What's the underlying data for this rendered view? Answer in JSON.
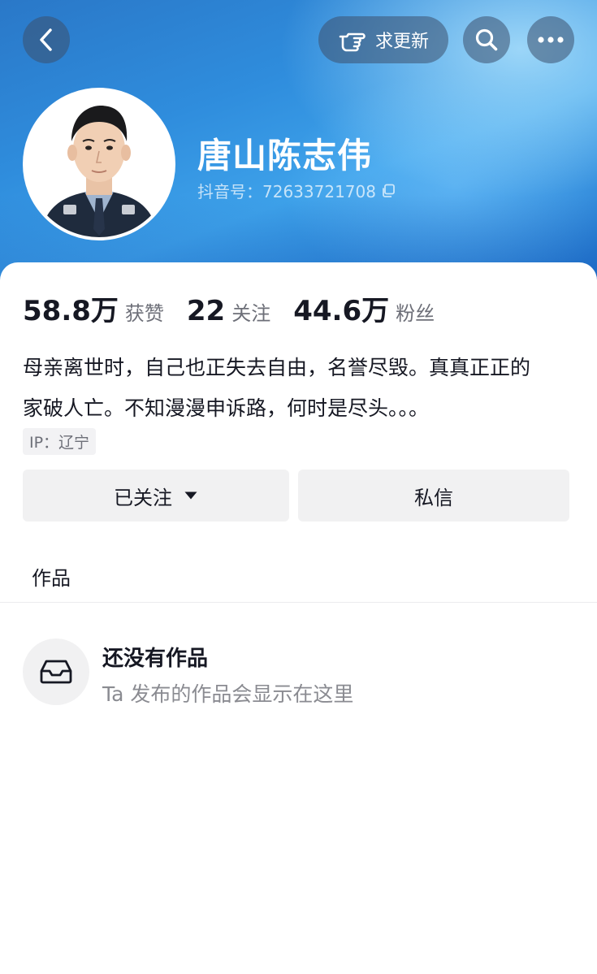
{
  "header": {
    "back_icon": "chevron-left-icon",
    "update_label": "求更新",
    "update_icon": "pointing-hand-icon",
    "search_icon": "search-icon",
    "more_icon": "more-dots-icon"
  },
  "profile": {
    "nickname": "唐山陈志伟",
    "douyin_id": "抖音号：72633721708",
    "copy_icon": "copy-icon"
  },
  "stats": [
    {
      "value": "58.8万",
      "label": "获赞"
    },
    {
      "value": "22",
      "label": "关注"
    },
    {
      "value": "44.6万",
      "label": "粉丝"
    }
  ],
  "bio": {
    "line1": "母亲离世时，自己也正失去自由，名誉尽毁。真真正正的",
    "line2": "家破人亡。不知漫漫申诉路，何时是尽头。。。"
  },
  "ip_tag": "IP：辽宁",
  "actions": {
    "follow_label": "已关注",
    "message_label": "私信"
  },
  "tabs": [
    {
      "label": "作品"
    }
  ],
  "empty_state": {
    "icon": "inbox-tray-icon",
    "title": "还没有作品",
    "subtitle": "Ta 发布的作品会显示在这里"
  },
  "colors": {
    "header_blue": "#2f8ddd",
    "text_primary": "#161823",
    "text_secondary": "#6d6f78",
    "button_bg": "#f1f1f2"
  }
}
